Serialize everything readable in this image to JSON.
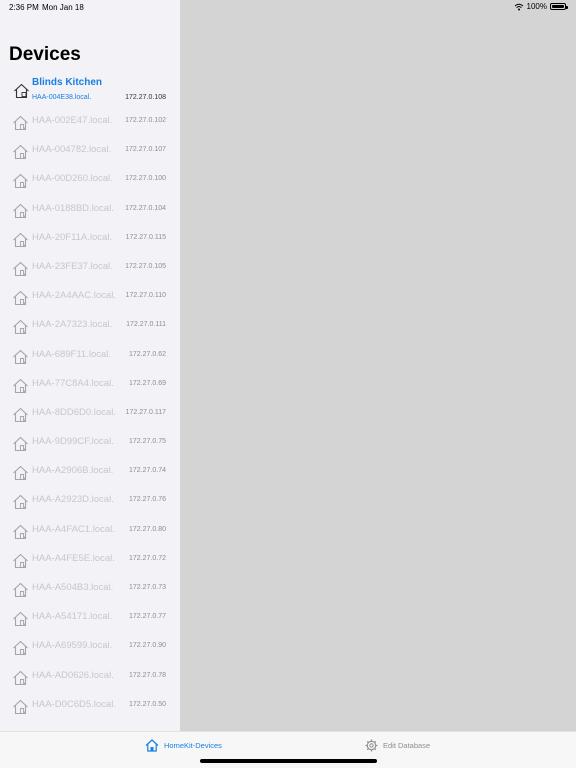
{
  "status": {
    "time": "2:36 PM",
    "date": "Mon Jan 18",
    "battery": "100%"
  },
  "sidebar": {
    "title": "Devices",
    "selected": {
      "label": "Blinds Kitchen",
      "host": "HAA-004E38.local.",
      "ip": "172.27.0.108"
    },
    "devices": [
      {
        "host": "HAA-002E47.local.",
        "ip": "172.27.0.102"
      },
      {
        "host": "HAA-004782.local.",
        "ip": "172.27.0.107"
      },
      {
        "host": "HAA-00D260.local.",
        "ip": "172.27.0.100"
      },
      {
        "host": "HAA-0188BD.local.",
        "ip": "172.27.0.104"
      },
      {
        "host": "HAA-20F11A.local.",
        "ip": "172.27.0.115"
      },
      {
        "host": "HAA-23FE37.local.",
        "ip": "172.27.0.105"
      },
      {
        "host": "HAA-2A4AAC.local.",
        "ip": "172.27.0.110"
      },
      {
        "host": "HAA-2A7323.local.",
        "ip": "172.27.0.111"
      },
      {
        "host": "HAA-689F11.local.",
        "ip": "172.27.0.62"
      },
      {
        "host": "HAA-77C8A4.local.",
        "ip": "172.27.0.69"
      },
      {
        "host": "HAA-8DD6D0.local.",
        "ip": "172.27.0.117"
      },
      {
        "host": "HAA-9D99CF.local.",
        "ip": "172.27.0.75"
      },
      {
        "host": "HAA-A2906B.local.",
        "ip": "172.27.0.74"
      },
      {
        "host": "HAA-A2923D.local.",
        "ip": "172.27.0.76"
      },
      {
        "host": "HAA-A4FAC1.local.",
        "ip": "172.27.0.80"
      },
      {
        "host": "HAA-A4FE5E.local.",
        "ip": "172.27.0.72"
      },
      {
        "host": "HAA-A504B3.local.",
        "ip": "172.27.0.73"
      },
      {
        "host": "HAA-A54171.local.",
        "ip": "172.27.0.77"
      },
      {
        "host": "HAA-A69599.local.",
        "ip": "172.27.0.90"
      },
      {
        "host": "HAA-AD0626.local.",
        "ip": "172.27.0.78"
      },
      {
        "host": "HAA-D0C6D5.local.",
        "ip": "172.27.0.50"
      }
    ]
  },
  "tabs": {
    "home_label": "HomeKit-Devices",
    "db_label": "Edit Database",
    "home_icon": "house-icon",
    "db_icon": "gear-icon"
  },
  "colors": {
    "accent": "#1a7fe0",
    "sidebar_bg": "#f2f2f7",
    "detail_bg": "#d4d4d4"
  }
}
